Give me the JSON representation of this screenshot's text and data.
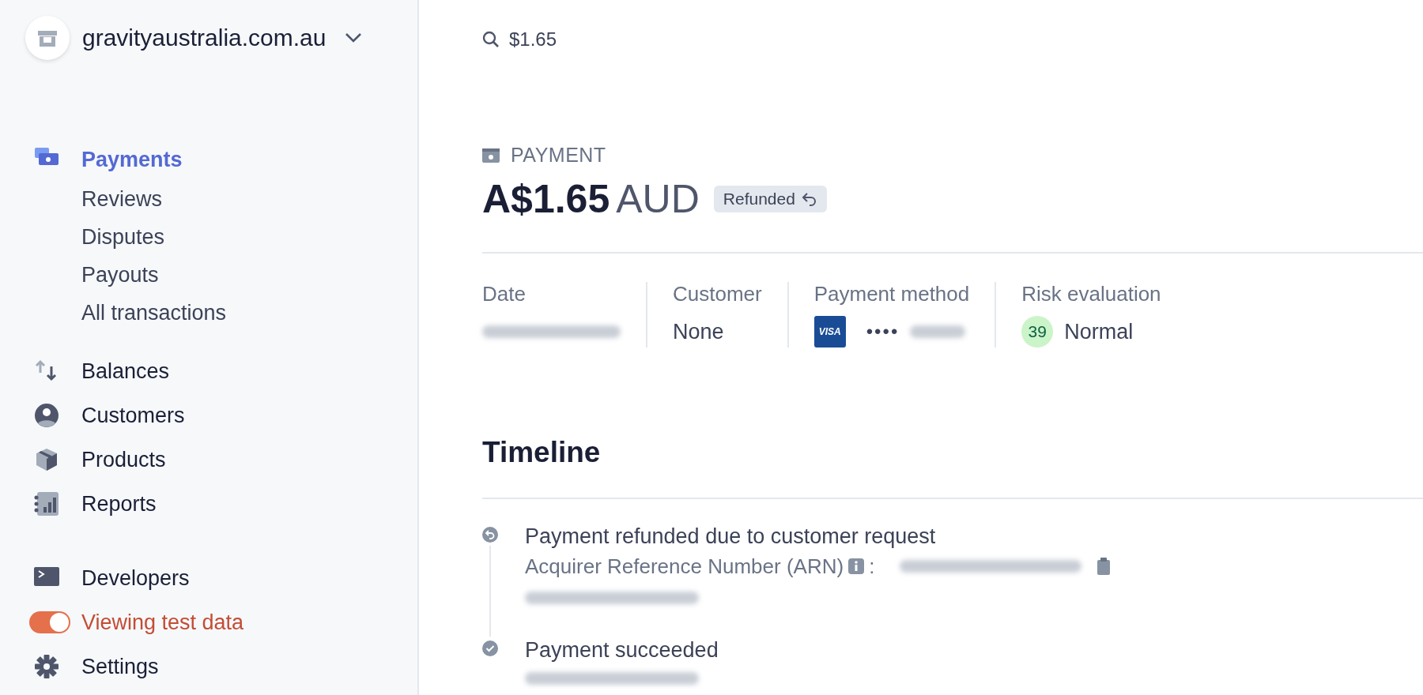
{
  "sidebar": {
    "account": {
      "name": "gravityaustralia.com.au"
    },
    "sections": [
      {
        "items": [
          {
            "kind": "nav",
            "label": "Payments",
            "selected": true,
            "children": [
              {
                "label": "Reviews",
                "selected": false
              },
              {
                "label": "Disputes",
                "selected": false
              },
              {
                "label": "Payouts",
                "selected": false
              },
              {
                "label": "All transactions",
                "selected": false
              }
            ]
          },
          {
            "kind": "nav",
            "label": "Balances",
            "selected": false
          },
          {
            "kind": "nav",
            "label": "Customers",
            "selected": false
          },
          {
            "kind": "nav",
            "label": "Products",
            "selected": false
          },
          {
            "kind": "nav",
            "label": "Reports",
            "selected": false
          }
        ]
      },
      {
        "items": [
          {
            "kind": "nav",
            "label": "Developers",
            "selected": false
          },
          {
            "kind": "toggle",
            "label": "Viewing test data",
            "on": true
          },
          {
            "kind": "nav",
            "label": "Settings",
            "selected": false
          }
        ]
      }
    ]
  },
  "search": {
    "value": "$1.65"
  },
  "payment": {
    "label": "PAYMENT",
    "amount": "A$1.65",
    "currency": "AUD",
    "status": {
      "label": "Refunded"
    }
  },
  "details": [
    {
      "kind": "text",
      "label": "Date",
      "redacted": true
    },
    {
      "kind": "text",
      "label": "Customer",
      "value": "None"
    },
    {
      "kind": "card",
      "label": "Payment method",
      "brand": "VISA",
      "value": "••••",
      "redacted": true
    },
    {
      "kind": "risk",
      "label": "Risk evaluation",
      "score": "39",
      "value": "Normal"
    }
  ],
  "timeline": {
    "title": "Timeline",
    "events": [
      {
        "kind": "refund",
        "title": "Payment refunded due to customer request",
        "detail": "Acquirer Reference Number (ARN)",
        "separator": ":",
        "redacted": true
      },
      {
        "kind": "success",
        "title": "Payment succeeded",
        "redacted": true
      }
    ]
  }
}
